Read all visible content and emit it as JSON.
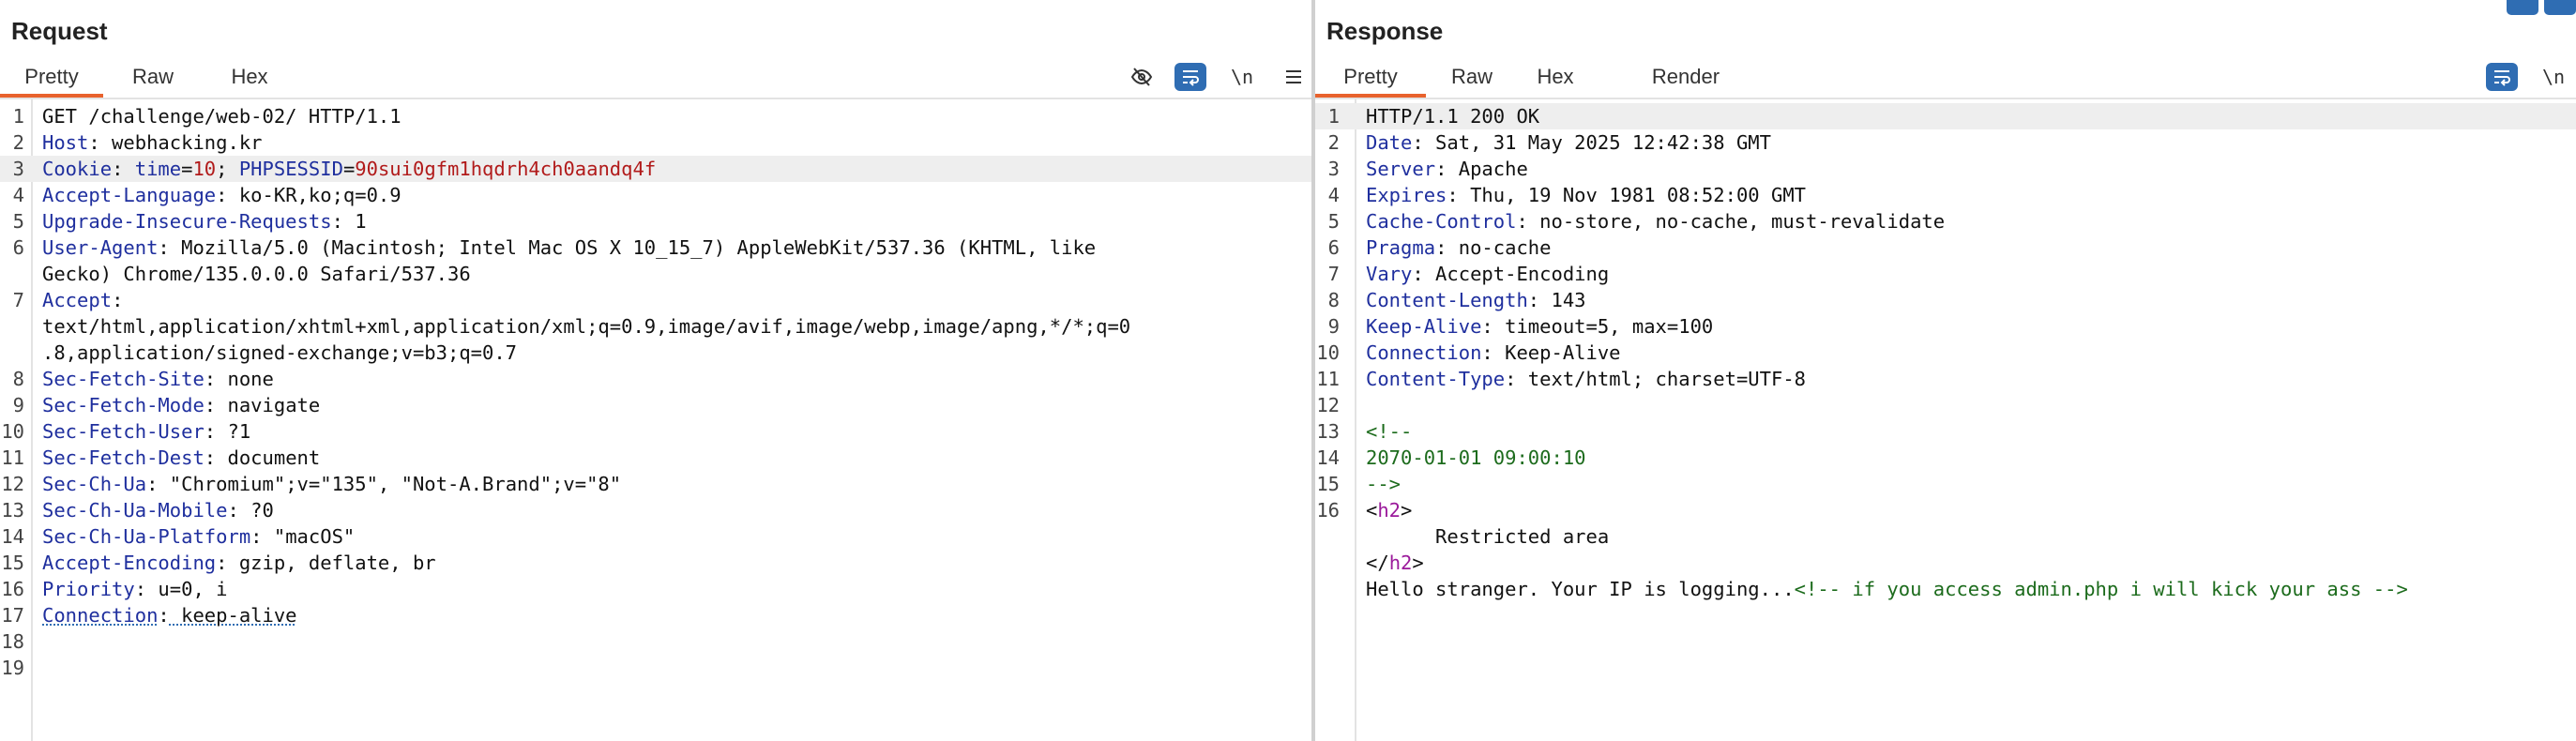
{
  "request": {
    "title": "Request",
    "tabs": [
      "Pretty",
      "Raw",
      "Hex"
    ],
    "active_tab": "Pretty",
    "tools": {
      "newline_label": "\\n"
    },
    "lines": [
      {
        "n": "1",
        "key": "",
        "text": "GET /challenge/web-02/ HTTP/1.1"
      },
      {
        "n": "2",
        "key": "Host",
        "text": " webhacking.kr"
      },
      {
        "n": "3",
        "key": "Cookie",
        "text": "",
        "cookies": [
          {
            "name": "time",
            "value": "10"
          },
          {
            "name": "PHPSESSID",
            "value": "90sui0gfm1hqdrh4ch0aandq4f"
          }
        ]
      },
      {
        "n": "4",
        "key": "Accept-Language",
        "text": " ko-KR,ko;q=0.9"
      },
      {
        "n": "5",
        "key": "Upgrade-Insecure-Requests",
        "text": " 1"
      },
      {
        "n": "6",
        "key": "User-Agent",
        "text": " Mozilla/5.0 (Macintosh; Intel Mac OS X 10_15_7) AppleWebKit/537.36 (KHTML, like"
      },
      {
        "n": "",
        "key": "",
        "text": "Gecko) Chrome/135.0.0.0 Safari/537.36"
      },
      {
        "n": "7",
        "key": "Accept",
        "text": ""
      },
      {
        "n": "",
        "key": "",
        "text": "text/html,application/xhtml+xml,application/xml;q=0.9,image/avif,image/webp,image/apng,*/*;q=0"
      },
      {
        "n": "",
        "key": "",
        "text": ".8,application/signed-exchange;v=b3;q=0.7"
      },
      {
        "n": "8",
        "key": "Sec-Fetch-Site",
        "text": " none"
      },
      {
        "n": "9",
        "key": "Sec-Fetch-Mode",
        "text": " navigate"
      },
      {
        "n": "10",
        "key": "Sec-Fetch-User",
        "text": " ?1"
      },
      {
        "n": "11",
        "key": "Sec-Fetch-Dest",
        "text": " document"
      },
      {
        "n": "12",
        "key": "Sec-Ch-Ua",
        "text": " \"Chromium\";v=\"135\", \"Not-A.Brand\";v=\"8\""
      },
      {
        "n": "13",
        "key": "Sec-Ch-Ua-Mobile",
        "text": " ?0"
      },
      {
        "n": "14",
        "key": "Sec-Ch-Ua-Platform",
        "text": " \"macOS\""
      },
      {
        "n": "15",
        "key": "Accept-Encoding",
        "text": " gzip, deflate, br"
      },
      {
        "n": "16",
        "key": "Priority",
        "text": " u=0, i"
      },
      {
        "n": "17",
        "key": "Connection",
        "text": " keep-alive"
      },
      {
        "n": "18",
        "key": "",
        "text": ""
      },
      {
        "n": "19",
        "key": "",
        "text": ""
      }
    ]
  },
  "response": {
    "title": "Response",
    "tabs": [
      "Pretty",
      "Raw",
      "Hex",
      "Render"
    ],
    "active_tab": "Pretty",
    "tools": {
      "newline_label": "\\n"
    },
    "lines": [
      {
        "n": "1",
        "key": "",
        "text": "HTTP/1.1 200 OK"
      },
      {
        "n": "2",
        "key": "Date",
        "text": " Sat, 31 May 2025 12:42:38 GMT"
      },
      {
        "n": "3",
        "key": "Server",
        "text": " Apache"
      },
      {
        "n": "4",
        "key": "Expires",
        "text": " Thu, 19 Nov 1981 08:52:00 GMT"
      },
      {
        "n": "5",
        "key": "Cache-Control",
        "text": " no-store, no-cache, must-revalidate"
      },
      {
        "n": "6",
        "key": "Pragma",
        "text": " no-cache"
      },
      {
        "n": "7",
        "key": "Vary",
        "text": " Accept-Encoding"
      },
      {
        "n": "8",
        "key": "Content-Length",
        "text": " 143"
      },
      {
        "n": "9",
        "key": "Keep-Alive",
        "text": " timeout=5, max=100"
      },
      {
        "n": "10",
        "key": "Connection",
        "text": " Keep-Alive"
      },
      {
        "n": "11",
        "key": "Content-Type",
        "text": " text/html; charset=UTF-8"
      },
      {
        "n": "12",
        "key": "",
        "text": ""
      },
      {
        "n": "13",
        "key": "",
        "text": "",
        "comment": "<!--"
      },
      {
        "n": "14",
        "key": "",
        "text": "",
        "comment": "2070-01-01 09:00:10"
      },
      {
        "n": "15",
        "key": "",
        "text": "",
        "comment": "-->"
      },
      {
        "n": "16",
        "key": "",
        "text": "",
        "tag_open": "<",
        "tag_name": "h2",
        "tag_close": ">"
      },
      {
        "n": "",
        "key": "",
        "text": "      Restricted area"
      },
      {
        "n": "",
        "key": "",
        "text": "",
        "tag_open": "</",
        "tag_name": "h2",
        "tag_close": ">"
      },
      {
        "n": "",
        "key": "",
        "text": "Hello stranger. Your IP is logging...",
        "trailing_comment": "<!-- if you access admin.php i will kick your ass -->"
      }
    ]
  },
  "colors": {
    "accent_tab": "#e8622d",
    "tool_active": "#2f6db3",
    "header_key": "#1f2f9e",
    "cookie_value": "#b11a1a",
    "comment": "#1c6b1c",
    "tag": "#9b1a9b"
  }
}
